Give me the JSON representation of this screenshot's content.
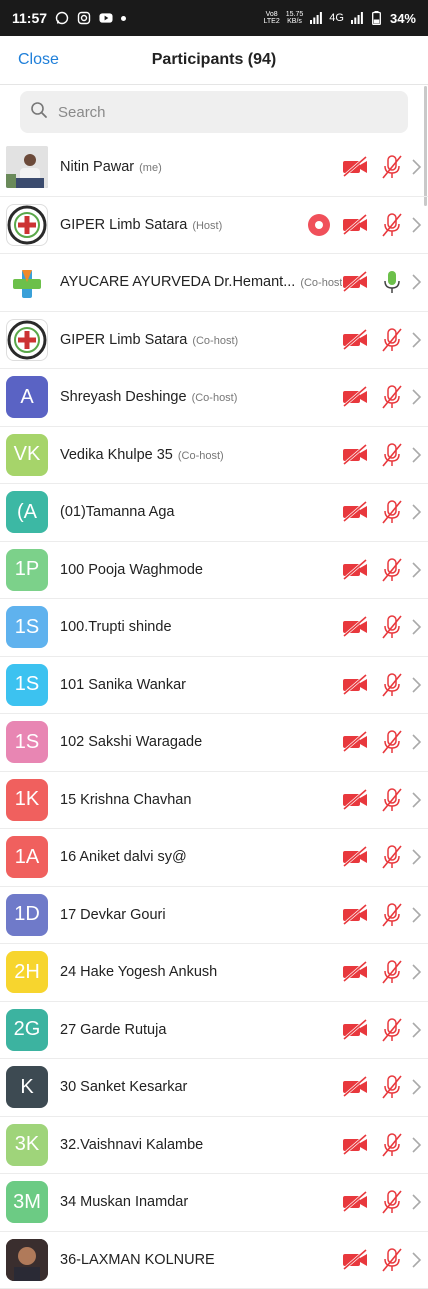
{
  "status_bar": {
    "time": "11:57",
    "net_top": "Vo8",
    "net_bottom": "LTE2",
    "speed_top": "15.75",
    "speed_bottom": "KB/s",
    "network": "4G",
    "battery": "34%"
  },
  "header": {
    "close_label": "Close",
    "title": "Participants (94)"
  },
  "search": {
    "placeholder": "Search"
  },
  "colors": {
    "accent": "#1f7fd9",
    "muted_red": "#e8383d",
    "unmuted_green": "#6cc04a"
  },
  "participants": [
    {
      "name": "Nitin Pawar",
      "role": "(me)",
      "avatar_text": "",
      "avatar_kind": "photo-me",
      "recording": false,
      "mic_on": false
    },
    {
      "name": "GIPER Limb Satara",
      "role": "(Host)",
      "avatar_text": "",
      "avatar_kind": "logo-giper",
      "recording": true,
      "mic_on": false
    },
    {
      "name": "AYUCARE AYURVEDA Dr.Hemant...",
      "role": "(Co-host)",
      "avatar_text": "",
      "avatar_kind": "logo-ayucare",
      "recording": false,
      "mic_on": true
    },
    {
      "name": "GIPER Limb Satara",
      "role": "(Co-host)",
      "avatar_text": "",
      "avatar_kind": "logo-giper",
      "recording": false,
      "mic_on": false
    },
    {
      "name": "Shreyash Deshinge",
      "role": "(Co-host)",
      "avatar_text": "A",
      "avatar_color": "#5a63c4",
      "recording": false,
      "mic_on": false
    },
    {
      "name": "Vedika Khulpe 35",
      "role": "(Co-host)",
      "avatar_text": "VK",
      "avatar_color": "#a6d46a",
      "recording": false,
      "mic_on": false
    },
    {
      "name": "(01)Tamanna Aga",
      "role": "",
      "avatar_text": "(A",
      "avatar_color": "#3cb8a4",
      "recording": false,
      "mic_on": false
    },
    {
      "name": "100 Pooja Waghmode",
      "role": "",
      "avatar_text": "1P",
      "avatar_color": "#7cd18a",
      "recording": false,
      "mic_on": false
    },
    {
      "name": "100.Trupti shinde",
      "role": "",
      "avatar_text": "1S",
      "avatar_color": "#5fb2ee",
      "recording": false,
      "mic_on": false
    },
    {
      "name": "101 Sanika Wankar",
      "role": "",
      "avatar_text": "1S",
      "avatar_color": "#3cc2f0",
      "recording": false,
      "mic_on": false
    },
    {
      "name": "102 Sakshi Waragade",
      "role": "",
      "avatar_text": "1S",
      "avatar_color": "#e886b3",
      "recording": false,
      "mic_on": false
    },
    {
      "name": "15 Krishna Chavhan",
      "role": "",
      "avatar_text": "1K",
      "avatar_color": "#f0605e",
      "recording": false,
      "mic_on": false
    },
    {
      "name": "16 Aniket dalvi sy@",
      "role": "",
      "avatar_text": "1A",
      "avatar_color": "#f0605e",
      "recording": false,
      "mic_on": false
    },
    {
      "name": "17 Devkar Gouri",
      "role": "",
      "avatar_text": "1D",
      "avatar_color": "#6f7ac9",
      "recording": false,
      "mic_on": false
    },
    {
      "name": "24 Hake Yogesh  Ankush",
      "role": "",
      "avatar_text": "2H",
      "avatar_color": "#f7d52e",
      "recording": false,
      "mic_on": false
    },
    {
      "name": "27 Garde Rutuja",
      "role": "",
      "avatar_text": "2G",
      "avatar_color": "#3cb3a0",
      "recording": false,
      "mic_on": false
    },
    {
      "name": "30 Sanket Kesarkar",
      "role": "",
      "avatar_text": "K",
      "avatar_color": "#3d4a52",
      "recording": false,
      "mic_on": false
    },
    {
      "name": "32.Vaishnavi Kalambe",
      "role": "",
      "avatar_text": "3K",
      "avatar_color": "#9fd47a",
      "recording": false,
      "mic_on": false
    },
    {
      "name": "34 Muskan Inamdar",
      "role": "",
      "avatar_text": "3M",
      "avatar_color": "#6ccb84",
      "recording": false,
      "mic_on": false
    },
    {
      "name": "36-LAXMAN KOLNURE",
      "role": "",
      "avatar_text": "",
      "avatar_kind": "photo-laxman",
      "recording": false,
      "mic_on": false
    }
  ]
}
